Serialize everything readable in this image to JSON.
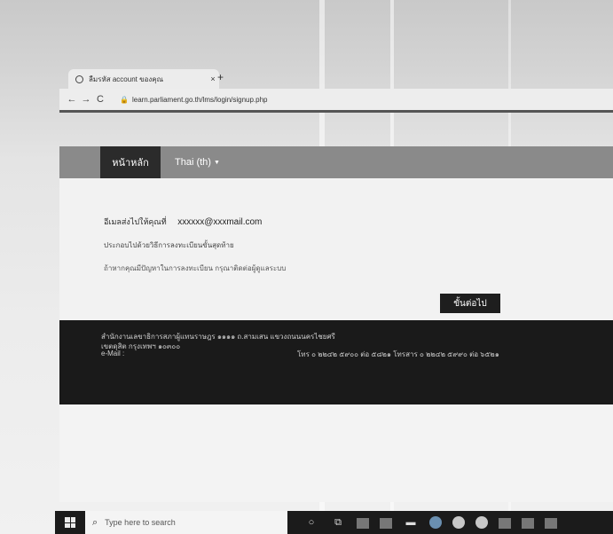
{
  "browser": {
    "tab_title": "ลืมรหัส account ของคุณ",
    "tab_close": "×",
    "new_tab": "+",
    "url": "learn.parliament.go.th/lms/login/signup.php"
  },
  "nav": {
    "home": "หน้าหลัก",
    "language": "Thai (th)"
  },
  "content": {
    "line1_label": "อีเมลส่งไปให้คุณที่",
    "line1_email": "xxxxxx@xxxmail.com",
    "line2": "ประกอบไปด้วยวิธีการลงทะเบียนขั้นสุดท้าย",
    "line3": "ถ้าหากคุณมีปัญหาในการลงทะเบียน กรุณาติดต่อผู้ดูแลระบบ",
    "next_button": "ขั้นต่อไป"
  },
  "footer": {
    "address1": "สำนักงานเลขาธิการสภาผู้แทนราษฎร ๑๑๑๑ ถ.สามเสน แขวงถนนนครไชยศรี",
    "address2": "เขตดุสิต กรุงเทพฯ ๑๐๓๐๐",
    "email_label": "e-Mail :",
    "phone": "โทร ๐ ๒๒๔๒ ๕๙๐๐ ต่อ ๕๘๒๑ โทรสาร ๐ ๒๒๔๒ ๕๙๙๐ ต่อ ๖๕๒๑"
  },
  "taskbar": {
    "search_placeholder": "Type here to search"
  }
}
